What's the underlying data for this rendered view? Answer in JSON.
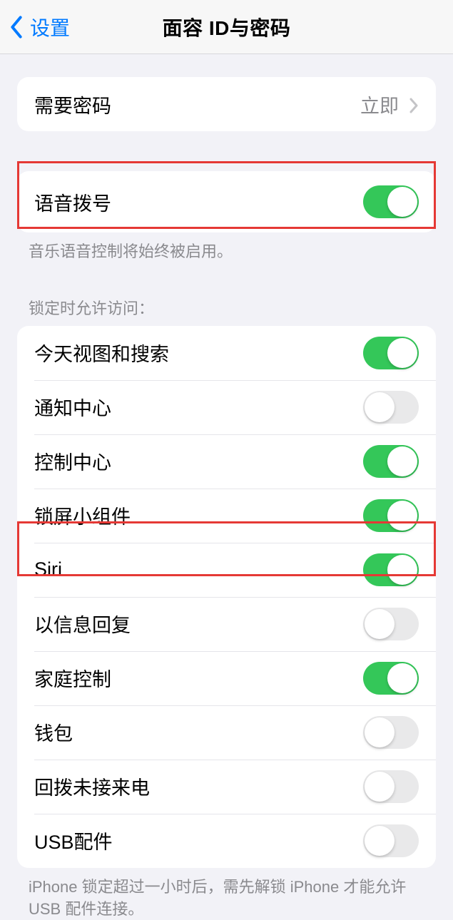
{
  "nav": {
    "back_label": "设置",
    "title": "面容 ID与密码"
  },
  "require_passcode": {
    "label": "需要密码",
    "value": "立即"
  },
  "voice_dial": {
    "label": "语音拨号",
    "footer": "音乐语音控制将始终被启用。"
  },
  "locked_access": {
    "header": "锁定时允许访问：",
    "items": [
      {
        "label": "今天视图和搜索",
        "on": true
      },
      {
        "label": "通知中心",
        "on": false
      },
      {
        "label": "控制中心",
        "on": true
      },
      {
        "label": "锁屏小组件",
        "on": true
      },
      {
        "label": "Siri",
        "on": true
      },
      {
        "label": "以信息回复",
        "on": false
      },
      {
        "label": "家庭控制",
        "on": true
      },
      {
        "label": "钱包",
        "on": false
      },
      {
        "label": "回拨未接来电",
        "on": false
      },
      {
        "label": "USB配件",
        "on": false
      }
    ],
    "footer": "iPhone 锁定超过一小时后，需先解锁 iPhone 才能允许USB 配件连接。"
  }
}
